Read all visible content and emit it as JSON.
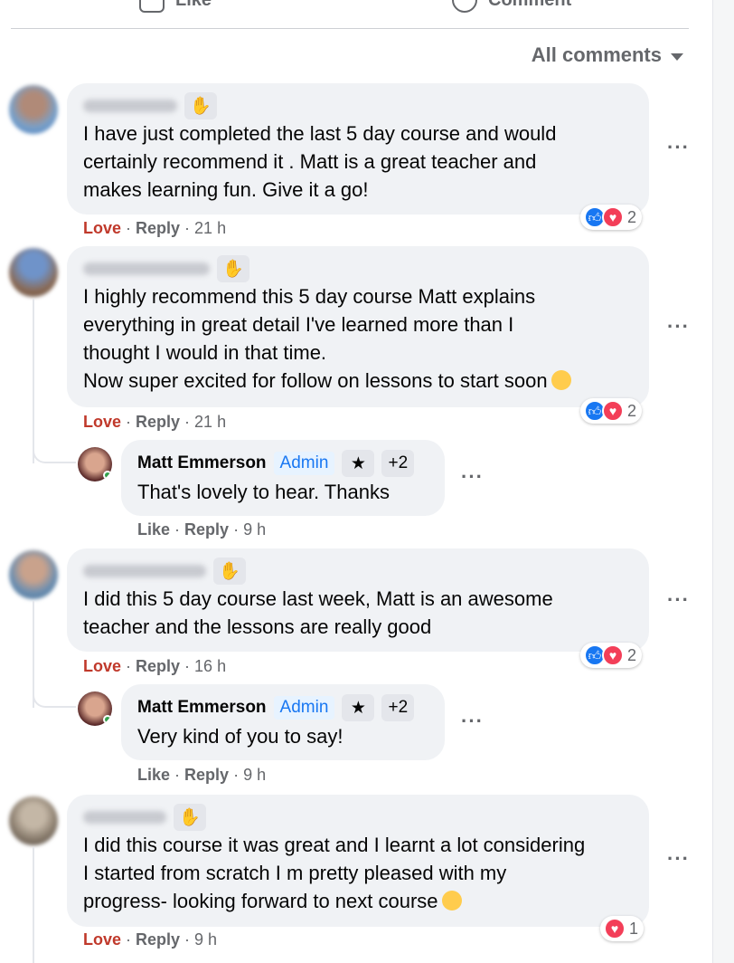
{
  "top_actions": {
    "like_label": "Like",
    "comment_label": "Comment"
  },
  "sort": {
    "label": "All comments"
  },
  "comments": [
    {
      "text": "I have just completed the last 5 day course and would\ncertainly recommend it . Matt is a great teacher and\nmakes learning fun. Give it a go!",
      "reaction": "Love",
      "reply": "Reply",
      "time": "21 h",
      "react_count": "2"
    },
    {
      "text": "I highly recommend this 5 day course Matt explains\neverything in great detail I've learned more than I\nthought I would in that time.\nNow super excited for follow on lessons to start soon",
      "reaction": "Love",
      "reply": "Reply",
      "time": "21 h",
      "react_count": "2",
      "reply_item": {
        "name": "Matt Emmerson",
        "badge": "Admin",
        "extra": "+2",
        "text": "That's lovely to hear. Thanks",
        "like": "Like",
        "reply": "Reply",
        "time": "9 h"
      }
    },
    {
      "text": "I did this 5 day course last week, Matt is an awesome\nteacher and the lessons are really good",
      "reaction": "Love",
      "reply": "Reply",
      "time": "16 h",
      "react_count": "2",
      "reply_item": {
        "name": "Matt Emmerson",
        "badge": "Admin",
        "extra": "+2",
        "text": "Very kind of you to say!",
        "like": "Like",
        "reply": "Reply",
        "time": "9 h"
      }
    },
    {
      "text": "I did this course it was great and I learnt a lot considering\nI started from scratch I m pretty pleased with my\nprogress- looking forward to next course",
      "reaction": "Love",
      "reply": "Reply",
      "time": "9 h",
      "react_count": "1"
    }
  ],
  "icons": {
    "more": "more-options-icon",
    "wave": "wave-hand-icon",
    "star": "top-fan-star-icon"
  },
  "colors": {
    "love": "#c0392b",
    "like_blue": "#1877f2",
    "heart_red": "#f33e58",
    "bubble": "#f0f2f5"
  }
}
